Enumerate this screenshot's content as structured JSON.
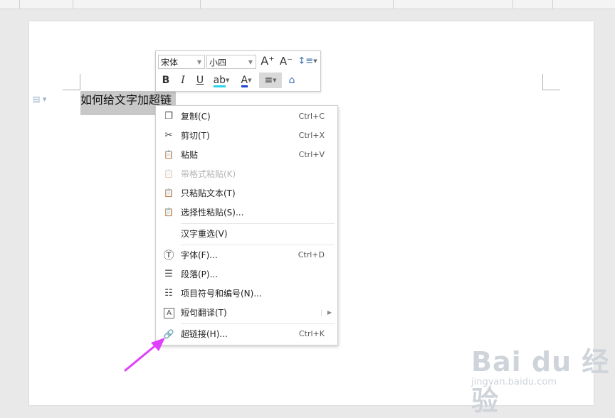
{
  "document": {
    "selected_text": "如何给文字加超链"
  },
  "mini_toolbar": {
    "font_name": "宋体",
    "font_size": "小四",
    "grow_font": "A⁺",
    "shrink_font": "A⁻",
    "line_spacing": "↕≡",
    "bold": "B",
    "italic": "I",
    "underline": "U",
    "highlight": "ab",
    "font_color": "A",
    "align": "≡",
    "format_painter": "⌂"
  },
  "context_menu": {
    "items": [
      {
        "icon": "copy-icon",
        "glyph": "❐",
        "label": "复制(C)",
        "shortcut": "Ctrl+C",
        "disabled": false
      },
      {
        "icon": "cut-icon",
        "glyph": "✂",
        "label": "剪切(T)",
        "shortcut": "Ctrl+X",
        "disabled": false
      },
      {
        "icon": "paste-icon",
        "glyph": "📋",
        "label": "粘贴",
        "shortcut": "Ctrl+V",
        "disabled": false
      },
      {
        "icon": "paste-format-icon",
        "glyph": "📋",
        "label": "带格式粘贴(K)",
        "shortcut": "",
        "disabled": true
      },
      {
        "icon": "paste-text-icon",
        "glyph": "📋",
        "label": "只粘贴文本(T)",
        "shortcut": "",
        "disabled": false
      },
      {
        "icon": "paste-special-icon",
        "glyph": "📋",
        "label": "选择性粘贴(S)...",
        "shortcut": "",
        "disabled": false
      },
      {
        "icon": "",
        "glyph": "",
        "label": "汉字重选(V)",
        "shortcut": "",
        "disabled": false
      },
      {
        "icon": "font-icon",
        "glyph": "Ⓣ",
        "label": "字体(F)...",
        "shortcut": "Ctrl+D",
        "disabled": false
      },
      {
        "icon": "paragraph-icon",
        "glyph": "☰",
        "label": "段落(P)...",
        "shortcut": "",
        "disabled": false
      },
      {
        "icon": "bullets-icon",
        "glyph": "☷",
        "label": "项目符号和编号(N)...",
        "shortcut": "",
        "disabled": false
      },
      {
        "icon": "translate-icon",
        "glyph": "A",
        "label": "短句翻译(T)",
        "shortcut": "",
        "disabled": false
      },
      {
        "icon": "hyperlink-icon",
        "glyph": "🔗",
        "label": "超链接(H)...",
        "shortcut": "Ctrl+K",
        "disabled": false
      }
    ]
  },
  "annotation": {
    "arrow_color": "#e040fb"
  },
  "watermark": {
    "brand": "Bai du 经验",
    "url": "jingyan.baidu.com"
  }
}
